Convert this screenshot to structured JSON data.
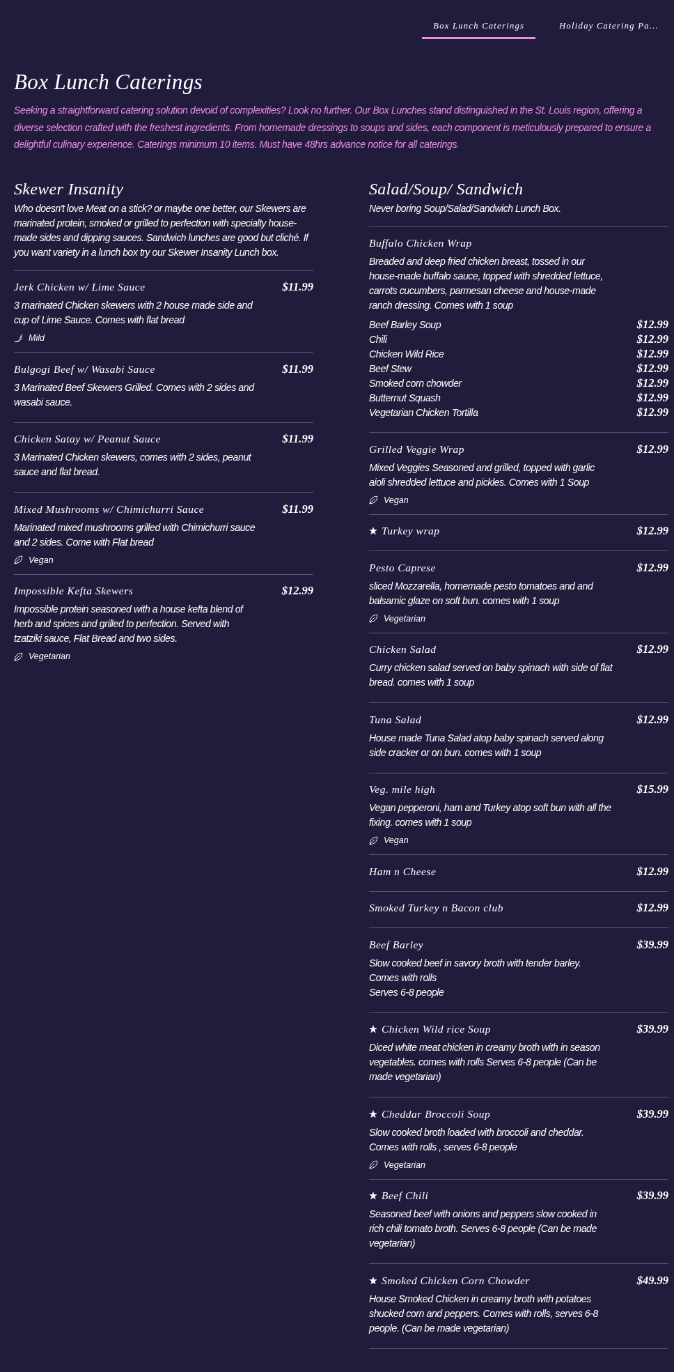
{
  "nav": {
    "tabs": [
      {
        "label": "Box Lunch Caterings",
        "selected": true
      },
      {
        "label": "Holiday Catering Pa...",
        "selected": false
      }
    ]
  },
  "page": {
    "title": "Box Lunch Caterings",
    "intro": "Seeking a straightforward catering solution devoid of complexities? Look no further. Our Box Lunches stand distinguished in the St. Louis region, offering a diverse selection crafted with the freshest ingredients. From homemade dressings to soups and sides, each component is meticulously prepared to ensure a delightful culinary experience. Caterings minimum 10 items. Must have 48hrs advance notice for all caterings."
  },
  "sections": [
    {
      "title": "Skewer Insanity",
      "description": "Who doesn't love Meat on a stick? or maybe one better, our Skewers are marinated protein, smoked or grilled to perfection with specialty house-made sides and dipping sauces. Sandwich lunches are good but cliché. If you want variety in a lunch box try our Skewer Insanity Lunch box.",
      "items": [
        {
          "name": "Jerk Chicken w/ Lime Sauce",
          "featured": false,
          "price": "$11.99",
          "description": "3 marinated Chicken skewers with 2 house made side and cup of Lime Sauce. Comes with flat bread",
          "tag": {
            "kind": "spice",
            "label": "Mild"
          }
        },
        {
          "name": "Bulgogi Beef w/ Wasabi Sauce",
          "featured": false,
          "price": "$11.99",
          "description": "3 Marinated Beef Skewers Grilled. Comes with 2 sides and wasabi sauce."
        },
        {
          "name": "Chicken Satay w/ Peanut Sauce",
          "featured": false,
          "price": "$11.99",
          "description": "3 Marinated Chicken skewers, comes with 2 sides, peanut sauce and flat bread."
        },
        {
          "name": "Mixed Mushrooms w/ Chimichurri Sauce",
          "featured": false,
          "price": "$11.99",
          "description": "Marinated mixed mushrooms grilled with Chimichurri sauce and 2 sides. Come with Flat bread",
          "tag": {
            "kind": "plant",
            "label": "Vegan"
          }
        },
        {
          "name": "Impossible Kefta Skewers",
          "featured": false,
          "price": "$12.99",
          "description": "Impossible protein seasoned with a house kefta blend of herb and spices and grilled to perfection. Served with tzatziki sauce, Flat Bread and two sides.",
          "tag": {
            "kind": "plant",
            "label": "Vegetarian"
          }
        }
      ]
    },
    {
      "title": "Salad/Soup/ Sandwich",
      "description": "Never boring Soup/Salad/Sandwich Lunch Box.",
      "items": [
        {
          "name": "Buffalo Chicken Wrap",
          "featured": false,
          "description": "Breaded and deep fried chicken breast, tossed in our house-made buffalo sauce, topped with shredded lettuce, carrots cucumbers, parmesan cheese and house-made ranch dressing. Comes with 1 soup",
          "options": [
            {
              "name": "Beef Barley Soup",
              "price": "$12.99"
            },
            {
              "name": "Chili",
              "price": "$12.99"
            },
            {
              "name": "Chicken Wild Rice",
              "price": "$12.99"
            },
            {
              "name": "Beef Stew",
              "price": "$12.99"
            },
            {
              "name": "Smoked corn chowder",
              "price": "$12.99"
            },
            {
              "name": "Butternut Squash",
              "price": "$12.99"
            },
            {
              "name": "Vegetarian Chicken Tortilla",
              "price": "$12.99"
            }
          ]
        },
        {
          "name": "Grilled Veggie Wrap",
          "featured": false,
          "price": "$12.99",
          "description": "Mixed Veggies Seasoned and grilled, topped with garlic aioli shredded lettuce and pickles. Comes with 1 Soup",
          "tag": {
            "kind": "plant",
            "label": "Vegan"
          }
        },
        {
          "name": "Turkey wrap",
          "featured": true,
          "price": "$12.99"
        },
        {
          "name": "Pesto Caprese",
          "featured": false,
          "price": "$12.99",
          "description": "sliced Mozzarella, homemade pesto tomatoes and and balsamic glaze on soft bun. comes with 1 soup",
          "tag": {
            "kind": "plant",
            "label": "Vegetarian"
          }
        },
        {
          "name": "Chicken Salad",
          "featured": false,
          "price": "$12.99",
          "description": "Curry chicken salad served on baby spinach with side of flat bread. comes with 1 soup"
        },
        {
          "name": "Tuna Salad",
          "featured": false,
          "price": "$12.99",
          "description": "House made Tuna Salad atop baby spinach served along side cracker or on bun. comes with 1 soup"
        },
        {
          "name": "Veg. mile high",
          "featured": false,
          "price": "$15.99",
          "description": "Vegan pepperoni, ham and Turkey atop soft bun with all the fixing. comes with 1 soup",
          "tag": {
            "kind": "plant",
            "label": "Vegan"
          }
        },
        {
          "name": "Ham n Cheese",
          "featured": false,
          "price": "$12.99"
        },
        {
          "name": "Smoked Turkey n Bacon club",
          "featured": false,
          "price": "$12.99"
        },
        {
          "name": "Beef Barley",
          "featured": false,
          "price": "$39.99",
          "description": "Slow cooked beef in savory broth with tender barley.\nComes with rolls\nServes 6-8 people"
        },
        {
          "name": "Chicken Wild rice Soup",
          "featured": true,
          "price": "$39.99",
          "description": "Diced white meat chicken in creamy broth with in season vegetables. comes with rolls Serves 6-8 people (Can be made vegetarian)"
        },
        {
          "name": "Cheddar Broccoli Soup",
          "featured": true,
          "price": "$39.99",
          "description": "Slow cooked broth loaded with broccoli and cheddar. Comes with rolls , serves 6-8 people",
          "tag": {
            "kind": "plant",
            "label": "Vegetarian"
          }
        },
        {
          "name": "Beef Chili",
          "featured": true,
          "price": "$39.99",
          "description": "Seasoned beef with onions and peppers slow cooked in rich chili tomato broth. Serves 6-8 people (Can be made vegetarian)"
        },
        {
          "name": "Smoked Chicken Corn Chowder",
          "featured": true,
          "price": "$49.99",
          "description": "House Smoked Chicken in creamy broth with potatoes shucked corn and peppers. Comes with rolls, serves 6-8 people. (Can be made vegetarian)"
        }
      ]
    }
  ]
}
